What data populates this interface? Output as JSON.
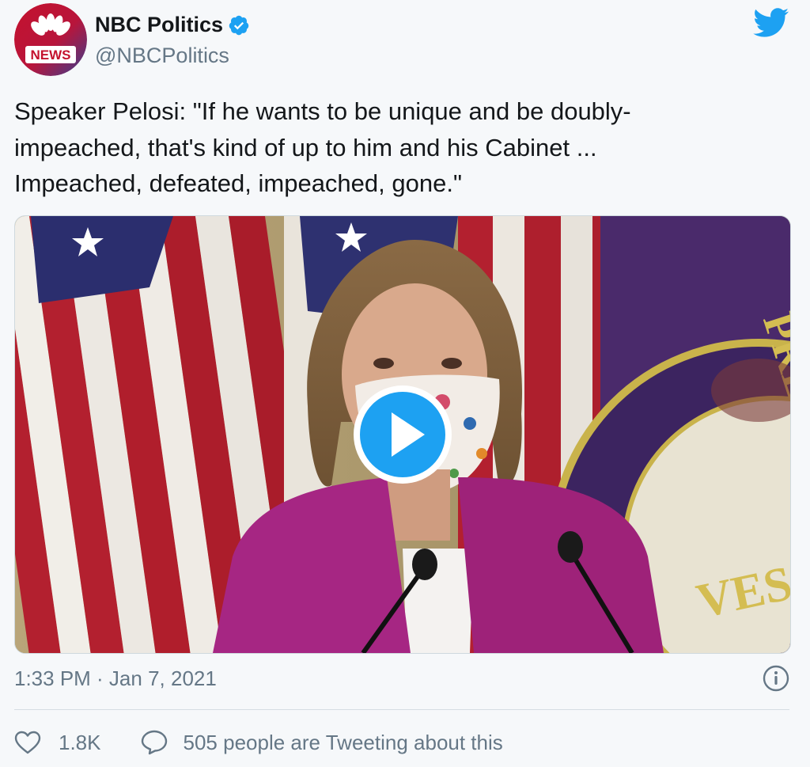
{
  "author": {
    "name": "NBC Politics",
    "handle": "@NBCPolitics",
    "avatar_text": "NEWS",
    "verified": true
  },
  "tweet": {
    "text_lines": [
      "Speaker Pelosi: \"If he wants to be unique and be doubly-",
      "impeached, that's kind of up to him and his Cabinet ...",
      "Impeached, defeated, impeached, gone.\""
    ]
  },
  "media": {
    "type": "video",
    "seal_text": "PRESEN",
    "seal_text_lower": "VES"
  },
  "meta": {
    "timestamp": "1:33 PM · Jan 7, 2021"
  },
  "actions": {
    "like_count": "1.8K",
    "conversation_label": "505 people are Tweeting about this"
  },
  "colors": {
    "twitter_blue": "#1da1f2",
    "text_primary": "#14171a",
    "text_secondary": "#657786",
    "background": "#f6f8fa"
  },
  "icons": {
    "verified": "verified-badge-icon",
    "brand": "twitter-bird-icon",
    "info": "info-icon",
    "like": "heart-icon",
    "reply": "speech-bubble-icon",
    "play": "play-icon"
  }
}
